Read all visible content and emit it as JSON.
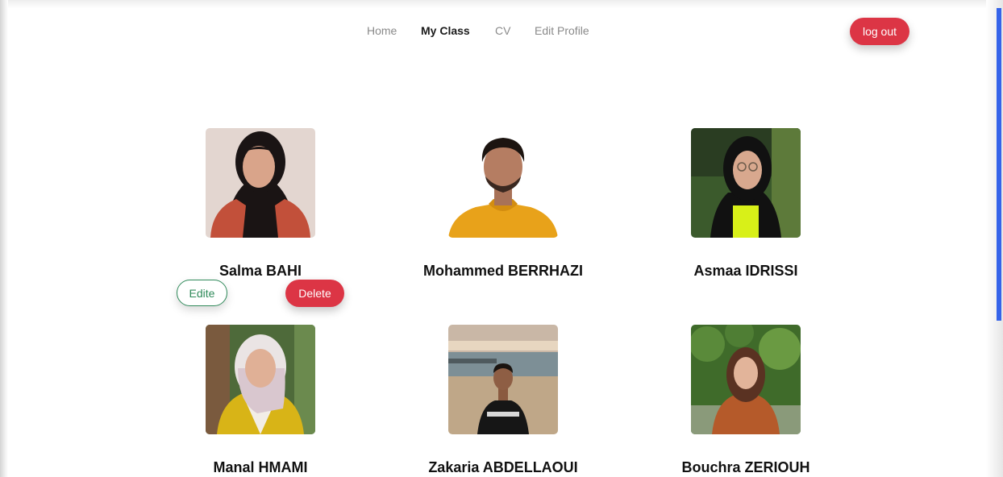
{
  "nav": {
    "links": [
      {
        "label": "Home",
        "active": false
      },
      {
        "label": "My Class",
        "active": true
      },
      {
        "label": "CV",
        "active": false
      },
      {
        "label": "Edit Profile",
        "active": false
      }
    ],
    "logout_label": "log out"
  },
  "students": [
    {
      "name": "Salma BAHI",
      "photo": "portrait of a woman in a black hijab and red blazer"
    },
    {
      "name": "Mohammed BERRHAZI",
      "photo": "portrait of a young man in a yellow hoodie"
    },
    {
      "name": "Asmaa IDRISSI",
      "photo": "portrait of a woman in a black hijab and glasses"
    },
    {
      "name": "Manal HMAMI",
      "photo": "portrait of a woman in a patterned hijab and yellow coat"
    },
    {
      "name": "Zakaria ABDELLAOUI",
      "photo": "young man on a beach in a black t-shirt"
    },
    {
      "name": "Bouchra ZERIOUH",
      "photo": "woman with long hair in a brown jacket among greenery"
    }
  ],
  "actions": {
    "edit_label": "Edite",
    "delete_label": "Delete"
  },
  "colors": {
    "danger": "#dc3545",
    "success_outline": "#2f8a5a",
    "scrollbar": "#3563e9"
  }
}
